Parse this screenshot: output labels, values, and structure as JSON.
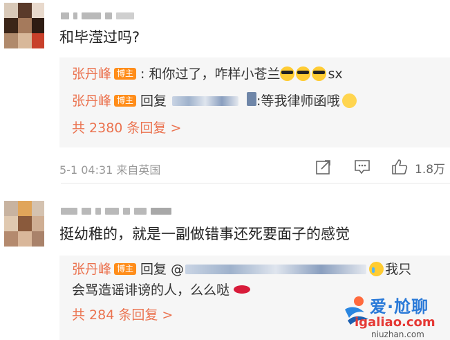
{
  "comments": [
    {
      "content": "和毕滢过吗?",
      "replies": [
        {
          "author": "张丹峰",
          "badge": "博主",
          "text_before": ": 和你过了，咋样小苍兰",
          "text_after": "sx"
        },
        {
          "author": "张丹峰",
          "badge": "博主",
          "prefix": "回复",
          "text_after": ":等我律师函哦"
        }
      ],
      "more_replies": "共 2380 条回复 >",
      "meta": "5-1 04:31  来自英国",
      "likes": "1.8万",
      "icons": [
        "share-icon",
        "comment-icon",
        "like-icon"
      ]
    },
    {
      "content": "挺幼稚的，就是一副做错事还死要面子的感觉",
      "replies": [
        {
          "author": "张丹峰",
          "badge": "博主",
          "prefix": "回复 @",
          "text_after": "我只",
          "line2": "会骂造谣诽谤的人，么么哒"
        }
      ],
      "more_replies": "共 284 条回复 >"
    }
  ],
  "watermark": {
    "title": "爱·尬聊",
    "url": "igaliao.com",
    "url2": "niuzhan.com"
  },
  "colors": {
    "author": "#eb7350",
    "badge": "#ff8d1a",
    "reply_bg": "#f6f6f6",
    "meta": "#999999"
  }
}
